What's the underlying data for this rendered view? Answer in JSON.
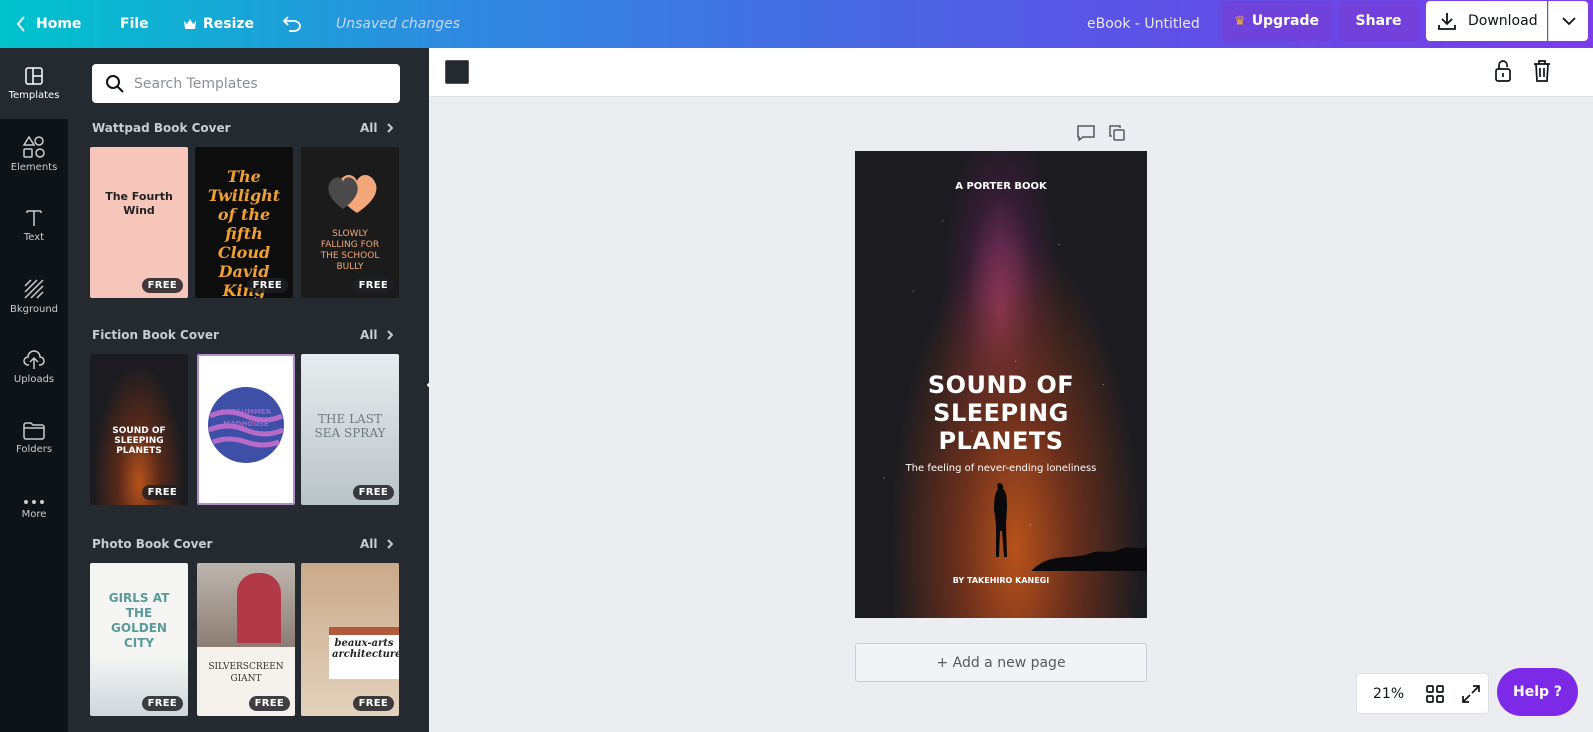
{
  "topbar": {
    "home": "Home",
    "file": "File",
    "resize": "Resize",
    "unsaved": "Unsaved changes",
    "doc_title": "eBook - Untitled",
    "upgrade": "Upgrade",
    "share": "Share",
    "download": "Download"
  },
  "rail": {
    "items": [
      {
        "label": "Templates",
        "icon": "templates-icon"
      },
      {
        "label": "Elements",
        "icon": "elements-icon"
      },
      {
        "label": "Text",
        "icon": "text-icon"
      },
      {
        "label": "Bkground",
        "icon": "background-icon"
      },
      {
        "label": "Uploads",
        "icon": "upload-icon"
      },
      {
        "label": "Folders",
        "icon": "folder-icon"
      },
      {
        "label": "More",
        "icon": "more-icon"
      }
    ]
  },
  "panel": {
    "search_placeholder": "Search Templates",
    "all_label": "All",
    "free_label": "FREE",
    "sections": [
      {
        "title": "Wattpad Book Cover",
        "thumbs": [
          "The Fourth Wind",
          "The Twilight of the fifth Cloud David King",
          "SLOWLY FALLING FOR THE SCHOOL BULLY"
        ]
      },
      {
        "title": "Fiction Book Cover",
        "thumbs": [
          "SOUND OF SLEEPING PLANETS",
          "MIDSUMMER MADHOUSE",
          "THE LAST SEA SPRAY"
        ]
      },
      {
        "title": "Photo Book Cover",
        "thumbs": [
          "GIRLS AT THE GOLDEN CITY",
          "SILVERSCREEN GIANT",
          "beaux-arts architecture"
        ]
      }
    ]
  },
  "cover": {
    "publisher": "A PORTER BOOK",
    "title_line1": "SOUND OF",
    "title_line2": "SLEEPING",
    "title_line3": "PLANETS",
    "subtitle": "The feeling of never-ending loneliness",
    "author": "BY TAKEHIRO KANEGI"
  },
  "canvas": {
    "add_page": "+ Add a new page",
    "zoom": "21%",
    "help": "Help ?"
  },
  "colors": {
    "accent": "#7d2ae8",
    "rail_bg": "#0e1318",
    "panel_bg": "#252a31"
  }
}
